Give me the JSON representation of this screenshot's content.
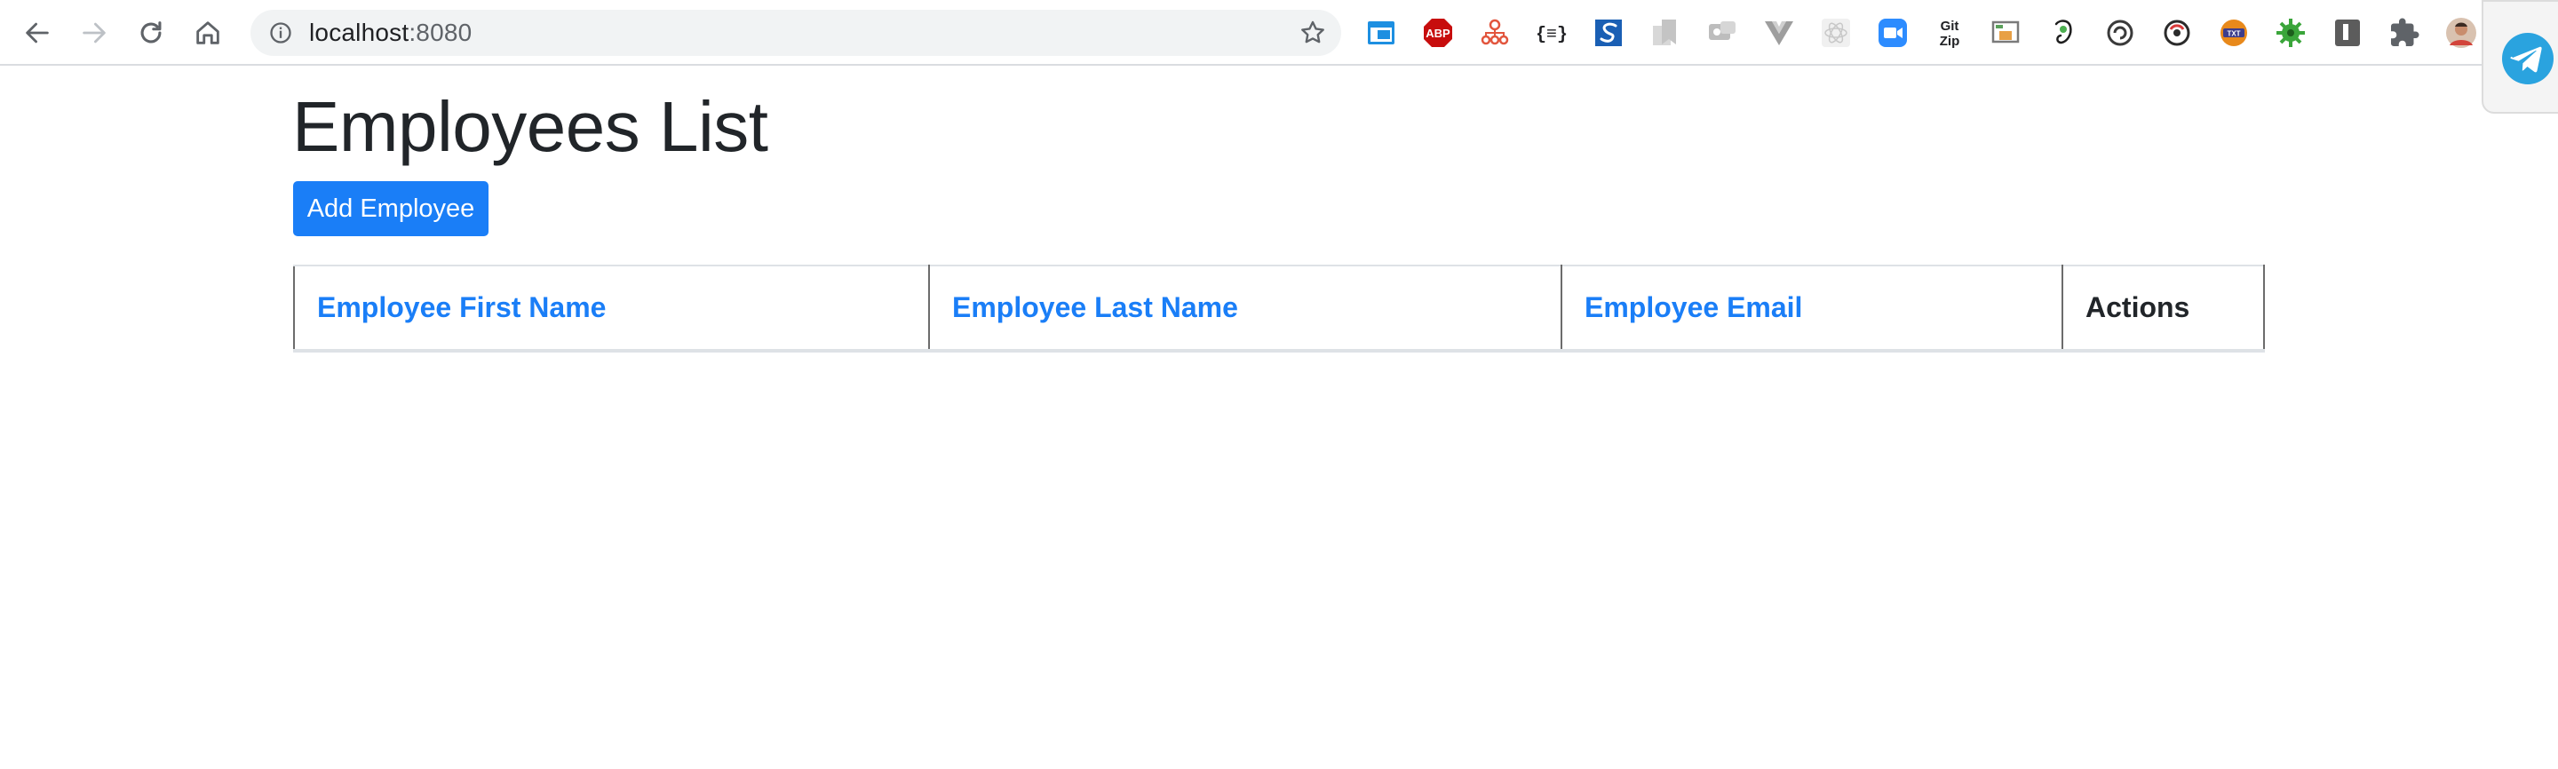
{
  "browser": {
    "url_host": "localhost",
    "url_port": ":8080",
    "nav_icons": [
      "back-arrow-icon",
      "forward-arrow-icon",
      "reload-icon",
      "home-icon"
    ],
    "extensions": [
      "calendar-icon",
      "adblock-plus-icon",
      "sitemap-icon",
      "json-braces-icon",
      "s-logo-icon",
      "bookmark-icon",
      "chat-icon",
      "vue-icon",
      "react-icon",
      "zoom-camera-icon",
      "gitzip-icon",
      "window-icon",
      "evernote-icon",
      "refresh-circle-icon",
      "rotate-circle-icon",
      "text-badge-icon",
      "gear-bug-icon",
      "shield-icon",
      "puzzle-icon",
      "profile-avatar-icon"
    ],
    "extension_text": {
      "abp": "ABP",
      "json": "{≡}",
      "gitzip_top": "Git",
      "gitzip_bottom": "Zip",
      "txt": "TXT"
    },
    "telegram": "telegram-icon"
  },
  "page": {
    "title": "Employees List",
    "add_button_label": "Add Employee"
  },
  "table": {
    "headers": [
      "Employee First Name",
      "Employee Last Name",
      "Employee Email",
      "Actions"
    ],
    "rows": []
  },
  "colors": {
    "primary": "#1a7ef7",
    "text": "#212529"
  }
}
